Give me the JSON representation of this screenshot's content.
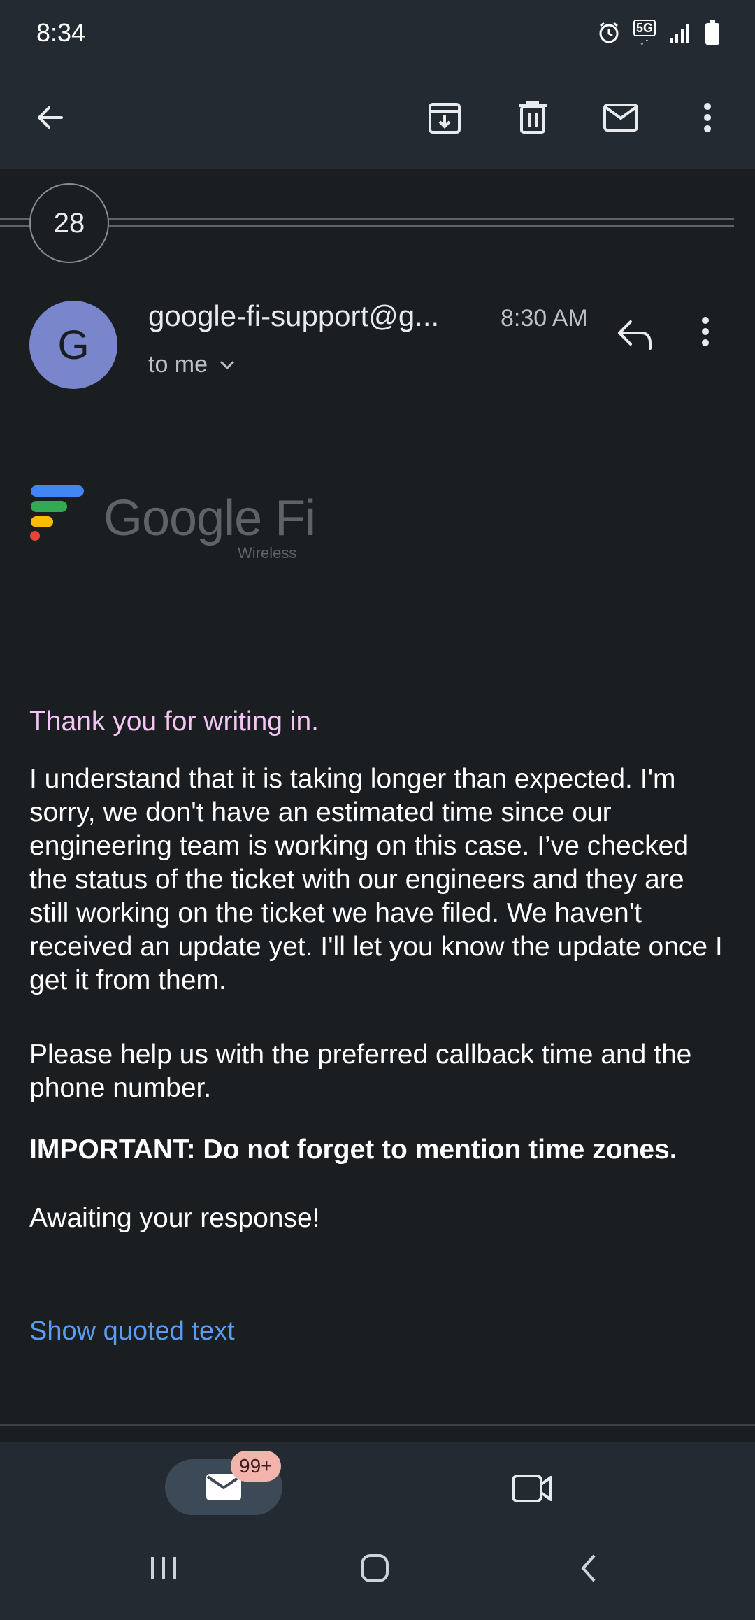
{
  "status_bar": {
    "time": "8:34",
    "network": "5G",
    "icons": [
      "alarm-icon",
      "5g-icon",
      "signal-icon",
      "battery-icon"
    ]
  },
  "toolbar": {
    "icons": [
      "back-arrow-icon",
      "archive-icon",
      "delete-icon",
      "mark-unread-icon",
      "more-vert-icon"
    ]
  },
  "thread": {
    "collapsed_count": "28"
  },
  "message": {
    "avatar_letter": "G",
    "sender": "google-fi-support@g...",
    "time": "8:30 AM",
    "recipient": "to me",
    "logo": {
      "brand": "Google Fi",
      "subtitle": "Wireless"
    },
    "greeting": "Thank you for writing in.",
    "paragraph1": "I understand that it is taking longer than expected. I'm sorry, we don't have an estimated time since our engineering team is working on this case. I’ve checked the status of the ticket with our engineers and they are still working on the ticket we have filed. We haven't received an update yet. I'll let you know the update once I get it from them.",
    "paragraph2": "Please help us with the preferred callback time and the phone number.",
    "important": "IMPORTANT: Do not forget to mention time zones.",
    "closing": "Awaiting your response!",
    "show_quoted": "Show quoted text"
  },
  "bottom_nav": {
    "mail_badge": "99+",
    "icons": [
      "mail-icon",
      "video-icon"
    ]
  },
  "colors": {
    "background": "#1b1e21",
    "bar": "#232a31",
    "avatar": "#7986cb",
    "link": "#5b9cf3",
    "greeting": "#f5c6f5"
  }
}
